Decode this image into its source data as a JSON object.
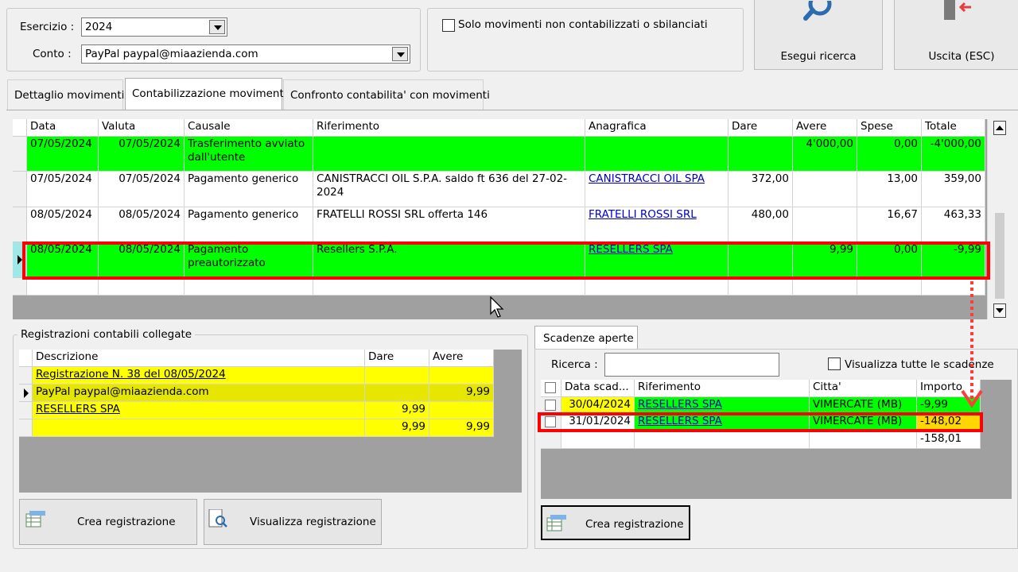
{
  "filters": {
    "esercizio_label": "Esercizio :",
    "esercizio_value": "2024",
    "conto_label": "Conto :",
    "conto_value": "PayPal paypal@miaazienda.com",
    "only_unposted_label": "Solo movimenti non contabilizzati o sbilanciati"
  },
  "toolbar": {
    "search_label": "Esegui ricerca",
    "exit_label": "Uscita (ESC)"
  },
  "tabs": [
    {
      "label": "Dettaglio movimenti"
    },
    {
      "label": "Contabilizzazione movimenti"
    },
    {
      "label": "Confronto contabilita' con movimenti"
    }
  ],
  "movements": {
    "columns": [
      "Data",
      "Valuta",
      "Causale",
      "Riferimento",
      "Anagrafica",
      "Dare",
      "Avere",
      "Spese",
      "Totale"
    ],
    "rows": [
      {
        "data": "07/05/2024",
        "valuta": "07/05/2024",
        "causale": "Trasferimento avviato dall'utente",
        "riferimento": "",
        "anagrafica": "",
        "dare": "",
        "avere": "4'000,00",
        "spese": "0,00",
        "totale": "-4'000,00"
      },
      {
        "data": "07/05/2024",
        "valuta": "07/05/2024",
        "causale": "Pagamento generico",
        "riferimento": "CANISTRACCI OIL S.P.A. saldo ft 636 del 27-02-2024",
        "anagrafica": "CANISTRACCI OIL SPA",
        "dare": "372,00",
        "avere": "",
        "spese": "13,00",
        "totale": "359,00"
      },
      {
        "data": "08/05/2024",
        "valuta": "08/05/2024",
        "causale": "Pagamento generico",
        "riferimento": "FRATELLI ROSSI SRL offerta 146",
        "anagrafica": "FRATELLI ROSSI SRL",
        "dare": "480,00",
        "avere": "",
        "spese": "16,67",
        "totale": "463,33"
      },
      {
        "data": "08/05/2024",
        "valuta": "08/05/2024",
        "causale": "Pagamento preautorizzato",
        "riferimento": "Resellers S.P.A.",
        "anagrafica": "RESELLERS SPA",
        "dare": "",
        "avere": "9,99",
        "spese": "0,00",
        "totale": "-9,99"
      }
    ]
  },
  "registrations": {
    "title": "Registrazioni contabili collegate",
    "columns": [
      "Descrizione",
      "Dare",
      "Avere"
    ],
    "rows": [
      {
        "descrizione": "Registrazione N. 38 del 08/05/2024",
        "dare": "",
        "avere": ""
      },
      {
        "descrizione": "PayPal paypal@miaazienda.com",
        "dare": "",
        "avere": "9,99"
      },
      {
        "descrizione": "RESELLERS SPA",
        "dare": "9,99",
        "avere": ""
      },
      {
        "descrizione": "",
        "dare": "9,99",
        "avere": "9,99"
      }
    ],
    "create_label": "Crea registrazione",
    "view_label": "Visualizza registrazione"
  },
  "deadlines": {
    "tab_label": "Scadenze aperte",
    "search_label": "Ricerca :",
    "search_value": "",
    "show_all_label": "Visualizza tutte le scadenze",
    "columns": [
      "Data scad...",
      "Riferimento",
      "Citta'",
      "Importo"
    ],
    "rows": [
      {
        "data": "30/04/2024",
        "riferimento": "RESELLERS SPA",
        "citta": "VIMERCATE (MB)",
        "importo": "-9,99"
      },
      {
        "data": "31/01/2024",
        "riferimento": "RESELLERS SPA",
        "citta": "VIMERCATE (MB)",
        "importo": "-148,02"
      }
    ],
    "total": "-158,01",
    "create_label": "Crea registrazione"
  },
  "colors": {
    "row_green": "#00ff00",
    "row_yellow": "#ffff00",
    "highlight_red": "#ff0000",
    "link_blue": "#0000cc"
  }
}
